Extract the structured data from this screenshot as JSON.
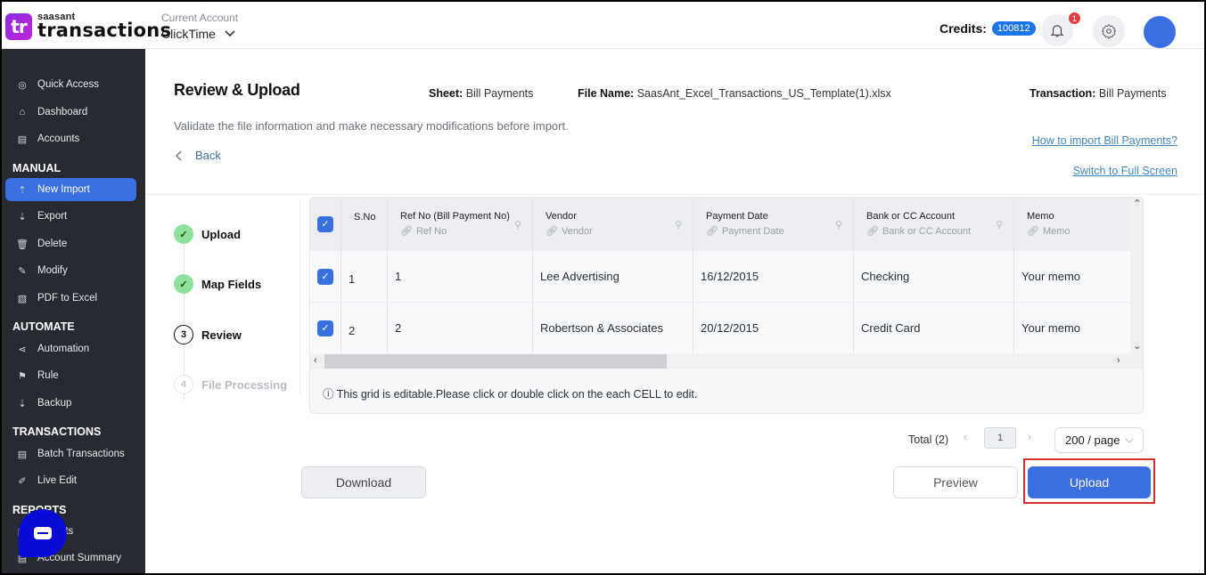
{
  "header": {
    "logo_mark": "tr",
    "brand_small": "saasant",
    "brand_big": "transactions",
    "account_label": "Current Account",
    "account_value": "ClickTime",
    "credits_label": "Credits:",
    "credits_value": "100812",
    "notification_count": "1"
  },
  "sidebar": {
    "items_top": [
      {
        "label": "Quick Access",
        "icon": "◎"
      },
      {
        "label": "Dashboard",
        "icon": "⌂"
      },
      {
        "label": "Accounts",
        "icon": "▤"
      }
    ],
    "sections": [
      {
        "title": "MANUAL",
        "items": [
          {
            "label": "New Import",
            "icon": "⇡",
            "active": true
          },
          {
            "label": "Export",
            "icon": "⇣"
          },
          {
            "label": "Delete",
            "icon": "🗑"
          },
          {
            "label": "Modify",
            "icon": "✎"
          },
          {
            "label": "PDF to Excel",
            "icon": "▧"
          }
        ]
      },
      {
        "title": "AUTOMATE",
        "items": [
          {
            "label": "Automation",
            "icon": "⋖"
          },
          {
            "label": "Rule",
            "icon": "⚑"
          },
          {
            "label": "Backup",
            "icon": "⇣"
          }
        ]
      },
      {
        "title": "TRANSACTIONS",
        "items": [
          {
            "label": "Batch Transactions",
            "icon": "▤"
          },
          {
            "label": "Live Edit",
            "icon": "✐"
          }
        ]
      },
      {
        "title": "REPORTS",
        "items": [
          {
            "label": "Reports",
            "icon": "▤"
          },
          {
            "label": "Account Summary",
            "icon": "▤"
          }
        ]
      }
    ]
  },
  "page": {
    "title": "Review & Upload",
    "sheet_label": "Sheet:",
    "sheet_value": "Bill Payments",
    "file_label": "File Name:",
    "file_value": "SaasAnt_Excel_Transactions_US_Template(1).xlsx",
    "transaction_label": "Transaction:",
    "transaction_value": "Bill Payments",
    "subtitle": "Validate the file information and make necessary modifications before import.",
    "back_label": "Back",
    "help_link": "How to import Bill Payments?",
    "fullscreen_link": "Switch to Full Screen"
  },
  "steps": [
    {
      "label": "Upload",
      "marker": "✓",
      "state": "done"
    },
    {
      "label": "Map Fields",
      "marker": "✓",
      "state": "done"
    },
    {
      "label": "Review",
      "marker": "3",
      "state": "current"
    },
    {
      "label": "File Processing",
      "marker": "4",
      "state": "pending"
    }
  ],
  "grid": {
    "columns": [
      {
        "title": "S.No",
        "mapped": ""
      },
      {
        "title": "Ref No (Bill Payment No)",
        "mapped": "Ref No"
      },
      {
        "title": "Vendor",
        "mapped": "Vendor"
      },
      {
        "title": "Payment Date",
        "mapped": "Payment Date"
      },
      {
        "title": "Bank or CC Account",
        "mapped": "Bank or CC Account"
      },
      {
        "title": "Memo",
        "mapped": "Memo"
      }
    ],
    "rows": [
      {
        "sno": "1",
        "ref": "1",
        "vendor": "Lee Advertising",
        "date": "16/12/2015",
        "bank": "Checking",
        "memo": "Your memo"
      },
      {
        "sno": "2",
        "ref": "2",
        "vendor": "Robertson & Associates",
        "date": "20/12/2015",
        "bank": "Credit Card",
        "memo": "Your memo"
      }
    ],
    "note": "ⓘ This grid is editable.Please click or double click on the each CELL to edit."
  },
  "pagination": {
    "total": "Total (2)",
    "current_page": "1",
    "page_size": "200 / page"
  },
  "buttons": {
    "download": "Download",
    "preview": "Preview",
    "upload": "Upload"
  }
}
